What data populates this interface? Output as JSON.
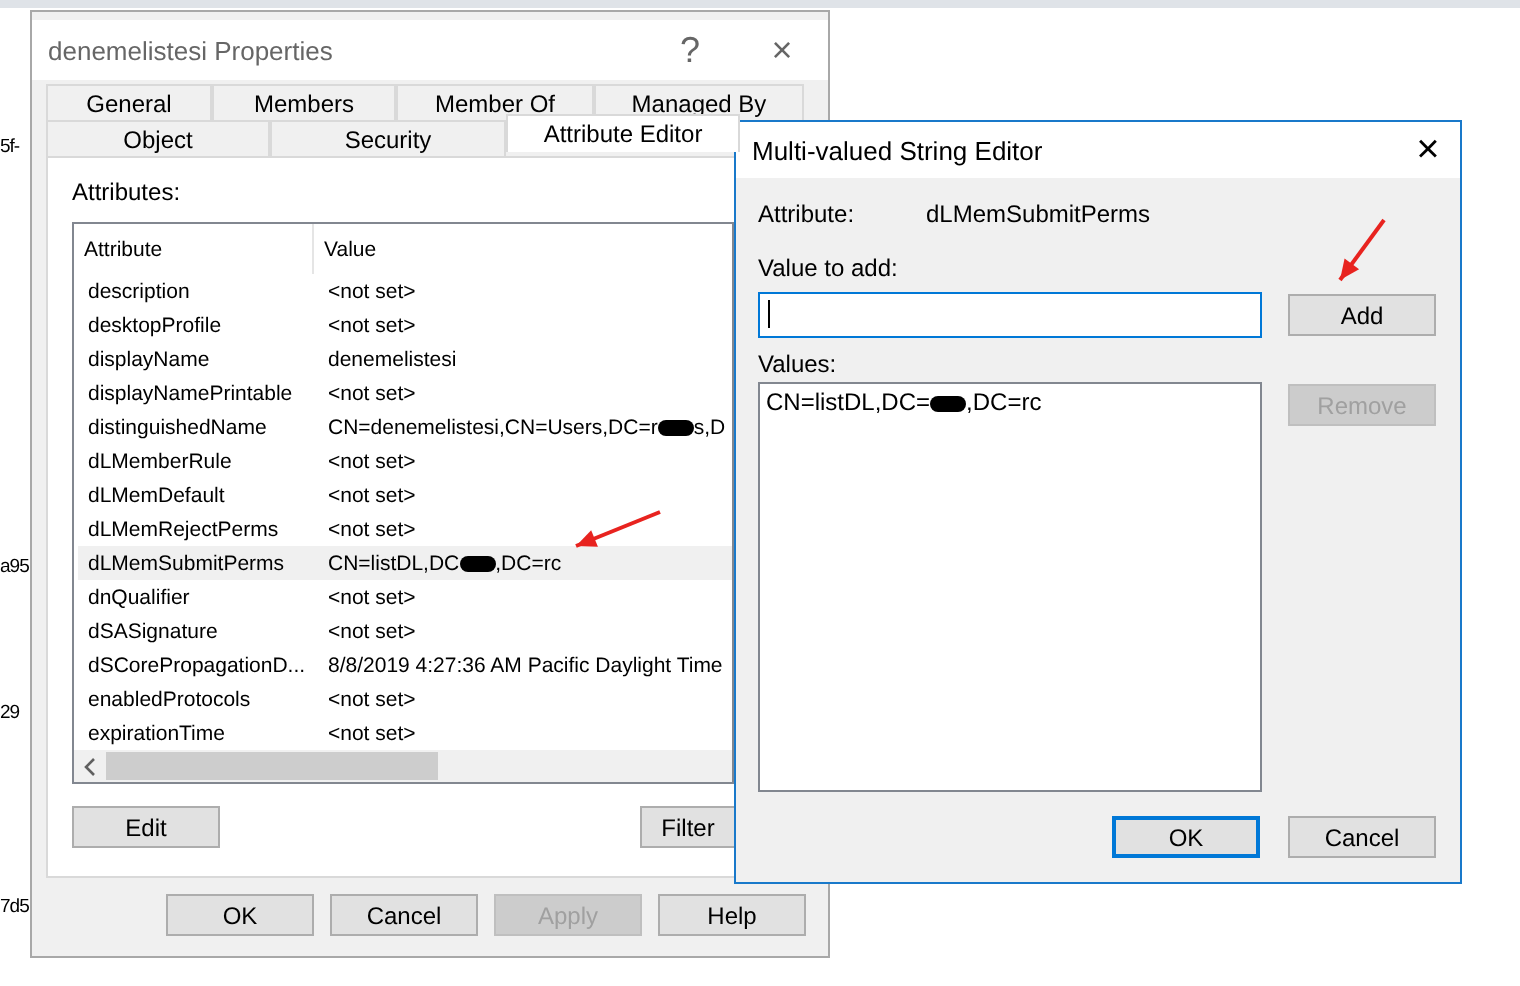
{
  "background_fragments": [
    "5f-",
    "a95",
    "29",
    "7d5"
  ],
  "properties_window": {
    "title": "denemelistesi Properties",
    "help_glyph": "?",
    "close_glyph": "×",
    "tabs_row_1": [
      {
        "label": "General",
        "selected": false
      },
      {
        "label": "Members",
        "selected": false
      },
      {
        "label": "Member Of",
        "selected": false
      },
      {
        "label": "Managed By",
        "selected": false
      }
    ],
    "tabs_row_2": [
      {
        "label": "Object",
        "selected": false
      },
      {
        "label": "Security",
        "selected": false
      },
      {
        "label": "Attribute Editor",
        "selected": true
      }
    ],
    "attributes_label": "Attributes:",
    "columns": [
      "Attribute",
      "Value"
    ],
    "rows": [
      {
        "attribute": "description",
        "value": "<not set>",
        "selected": false
      },
      {
        "attribute": "desktopProfile",
        "value": "<not set>",
        "selected": false
      },
      {
        "attribute": "displayName",
        "value": "denemelistesi",
        "selected": false
      },
      {
        "attribute": "displayNamePrintable",
        "value": "<not set>",
        "selected": false
      },
      {
        "attribute": "distinguishedName",
        "value": "CN=denemelistesi,CN=Users,DC=r",
        "redacted": true,
        "value_after": "s,D",
        "selected": false
      },
      {
        "attribute": "dLMemberRule",
        "value": "<not set>",
        "selected": false
      },
      {
        "attribute": "dLMemDefault",
        "value": "<not set>",
        "selected": false
      },
      {
        "attribute": "dLMemRejectPerms",
        "value": "<not set>",
        "selected": false
      },
      {
        "attribute": "dLMemSubmitPerms",
        "value": "CN=listDL,DC",
        "redacted": true,
        "value_after": ",DC=rc",
        "selected": true
      },
      {
        "attribute": "dnQualifier",
        "value": "<not set>",
        "selected": false
      },
      {
        "attribute": "dSASignature",
        "value": "<not set>",
        "selected": false
      },
      {
        "attribute": "dSCorePropagationD...",
        "value": "8/8/2019 4:27:36 AM Pacific Daylight Time",
        "selected": false
      },
      {
        "attribute": "enabledProtocols",
        "value": "<not set>",
        "selected": false
      },
      {
        "attribute": "expirationTime",
        "value": "<not set>",
        "selected": false
      }
    ],
    "edit_button": "Edit",
    "filter_button": "Filter",
    "footer_buttons": [
      {
        "label": "OK",
        "disabled": false
      },
      {
        "label": "Cancel",
        "disabled": false
      },
      {
        "label": "Apply",
        "disabled": true
      },
      {
        "label": "Help",
        "disabled": false
      }
    ]
  },
  "editor_window": {
    "title": "Multi-valued String Editor",
    "close_glyph": "×",
    "attribute_label": "Attribute:",
    "attribute_value": "dLMemSubmitPerms",
    "value_to_add_label": "Value to add:",
    "values_label": "Values:",
    "values": [
      {
        "text": "CN=listDL,DC=",
        "redacted": true,
        "text_after": ",DC=rc",
        "selected": false
      }
    ],
    "add_button": {
      "label": "Add",
      "disabled": false
    },
    "remove_button": {
      "label": "Remove",
      "disabled": true
    },
    "ok_button": {
      "label": "OK",
      "default": true
    },
    "cancel_button": {
      "label": "Cancel",
      "default": false
    }
  }
}
